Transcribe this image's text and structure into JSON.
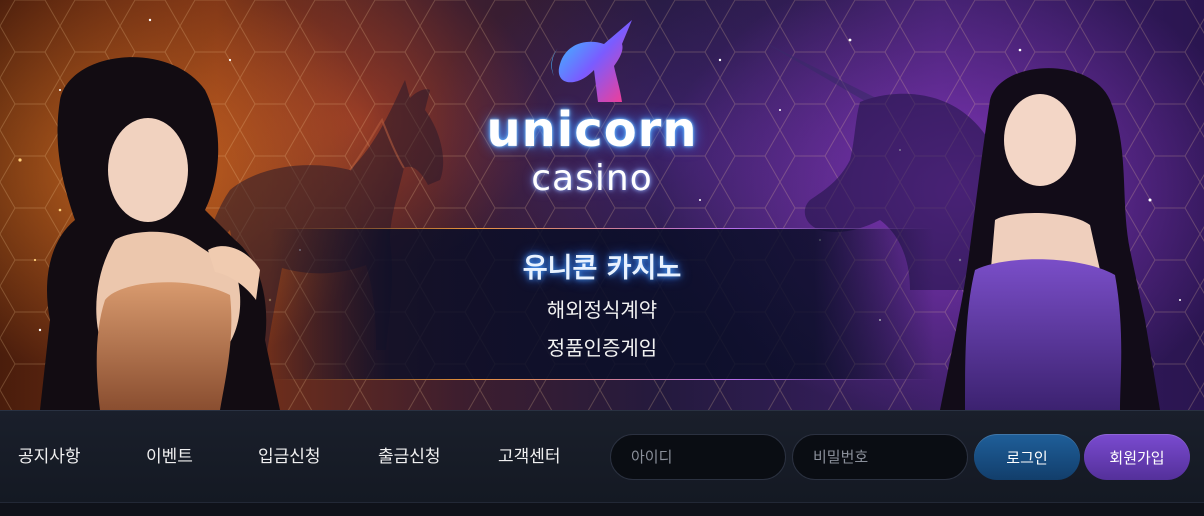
{
  "logo": {
    "word1": "unicorn",
    "word2": "casino"
  },
  "banner": {
    "title": "유니콘 카지노",
    "line1": "해외정식계약",
    "line2": "정품인증게임"
  },
  "nav": {
    "items": [
      {
        "label": "공지사항"
      },
      {
        "label": "이벤트"
      },
      {
        "label": "입금신청"
      },
      {
        "label": "출금신청"
      },
      {
        "label": "고객센터"
      }
    ]
  },
  "login": {
    "id_placeholder": "아이디",
    "pw_placeholder": "비밀번호",
    "login_label": "로그인",
    "join_label": "회원가입"
  },
  "colors": {
    "login_button": "#1f5f9a",
    "join_button": "#7a4bd0",
    "nav_background": "#1a1f2b"
  }
}
